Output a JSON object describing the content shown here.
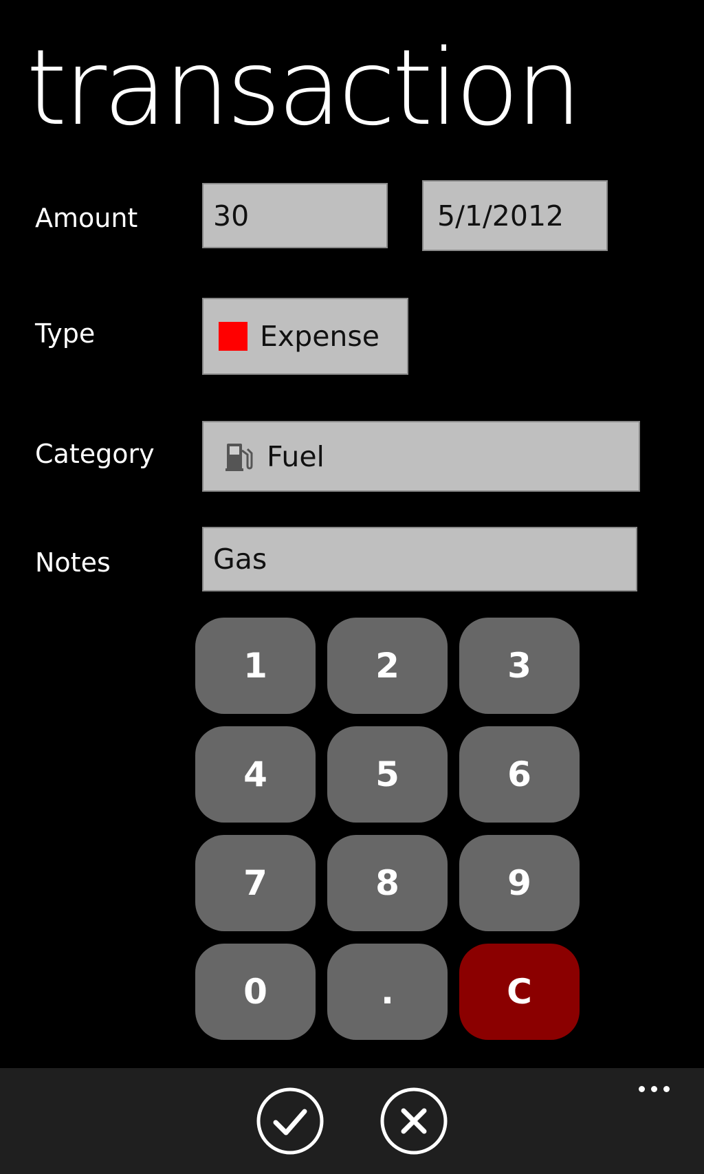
{
  "page": {
    "title": "transaction"
  },
  "form": {
    "amount_label": "Amount",
    "amount_value": "30",
    "date_value": "5/1/2012",
    "type_label": "Type",
    "type_value": "Expense",
    "type_color": "#ff0000",
    "category_label": "Category",
    "category_value": "Fuel",
    "category_icon": "fuel-pump-icon",
    "notes_label": "Notes",
    "notes_value": "Gas"
  },
  "keypad": {
    "keys": [
      "1",
      "2",
      "3",
      "4",
      "5",
      "6",
      "7",
      "8",
      "9",
      "0",
      ".",
      "C"
    ],
    "clear_color": "#8b0000"
  },
  "app_bar": {
    "buttons": [
      {
        "name": "save",
        "icon": "check-icon"
      },
      {
        "name": "cancel",
        "icon": "close-icon"
      }
    ],
    "more_icon": "more-ellipsis-icon"
  }
}
